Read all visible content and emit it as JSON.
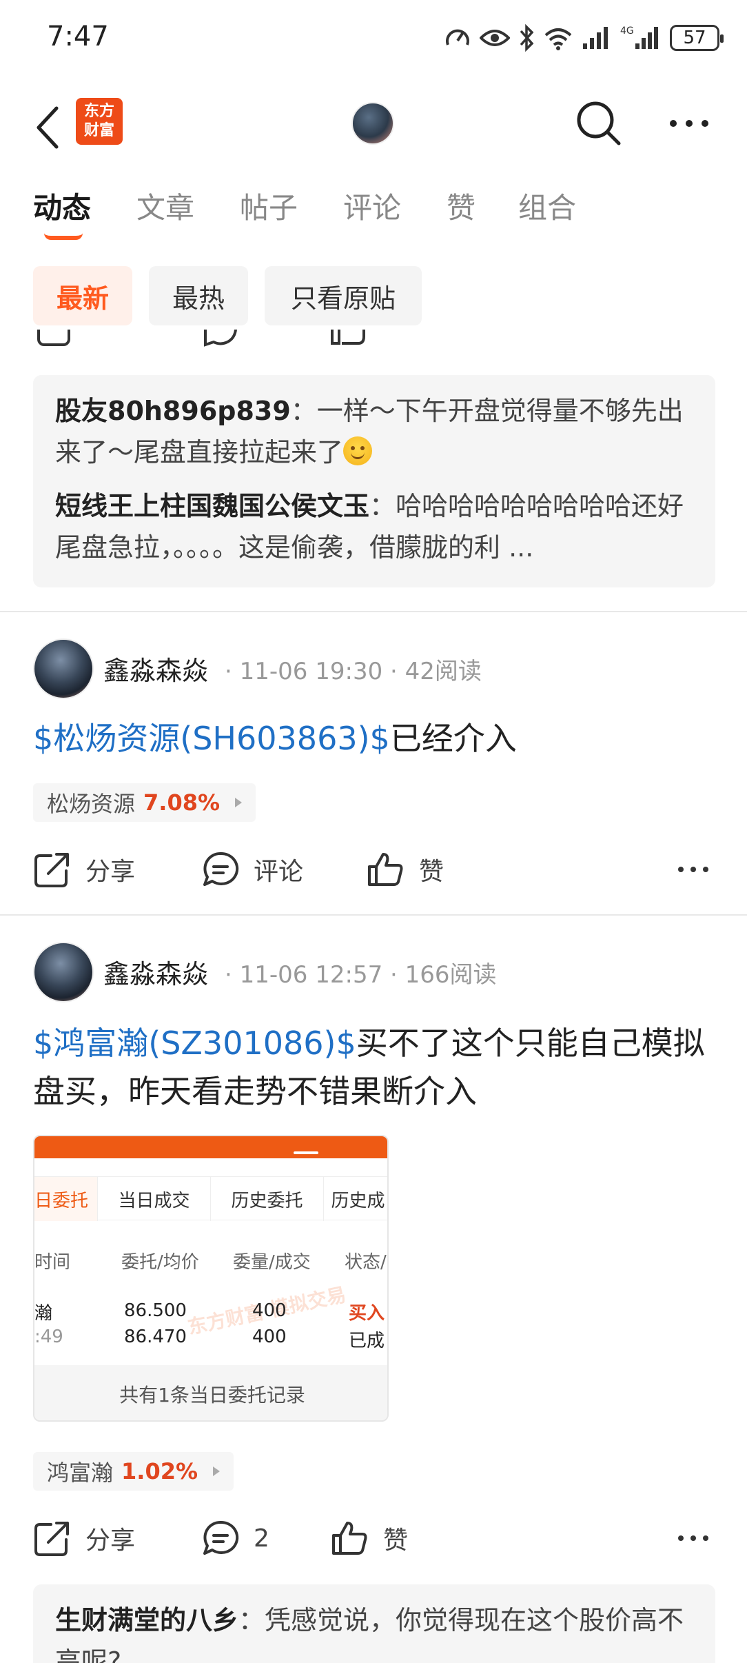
{
  "status_bar": {
    "time": "7:47",
    "battery": "57",
    "network": "4G"
  },
  "header": {
    "logo_line1": "东方",
    "logo_line2": "财富"
  },
  "tabs": [
    {
      "label": "动态"
    },
    {
      "label": "文章"
    },
    {
      "label": "帖子"
    },
    {
      "label": "评论"
    },
    {
      "label": "赞"
    },
    {
      "label": "组合"
    }
  ],
  "filters": [
    {
      "label": "最新"
    },
    {
      "label": "最热"
    },
    {
      "label": "只看原贴"
    }
  ],
  "top_comments": [
    {
      "user": "股友80h896p839",
      "sep": "：",
      "text": "一样～下午开盘觉得量不够先出来了～尾盘直接拉起来了"
    },
    {
      "user": "短线王上柱国魏国公侯文玉",
      "sep": "：",
      "text": "哈哈哈哈哈哈哈哈哈还好尾盘急拉，。。。。这是偷袭，借朦胧的利 ..."
    }
  ],
  "posts": [
    {
      "author": "鑫淼森焱",
      "meta": "· 11-06 19:30 · 42阅读",
      "link": "$松炀资源(SH603863)$",
      "text": "已经介入",
      "stock_name": "松炀资源",
      "stock_pct": "7.08%",
      "share": "分享",
      "comment": "评论",
      "like": "赞"
    },
    {
      "author": "鑫淼森焱",
      "meta": "· 11-06 12:57 · 166阅读",
      "link": "$鸿富瀚(SZ301086)$",
      "text": "买不了这个只能自己模拟盘买，昨天看走势不错果断介入",
      "stock_name": "鸿富瀚",
      "stock_pct": "1.02%",
      "share": "分享",
      "comment": "2",
      "like": "赞",
      "image": {
        "tabs": [
          "日委托",
          "当日成交",
          "历史委托",
          "历史成"
        ],
        "headers": [
          "时间",
          "委托/均价",
          "委量/成交",
          "状态/"
        ],
        "row_name": "瀚",
        "row_time": ":49",
        "price1": "86.500",
        "price2": "86.470",
        "qty1": "400",
        "qty2": "400",
        "status1": "买入",
        "status2": "已成",
        "footer": "共有1条当日委托记录",
        "watermark": "东方财富 模拟交易"
      }
    }
  ],
  "bottom_comment": {
    "user": "生财满堂的八乡",
    "sep": "：",
    "text": "凭感觉说，你觉得现在这个股价高不高呢?"
  }
}
